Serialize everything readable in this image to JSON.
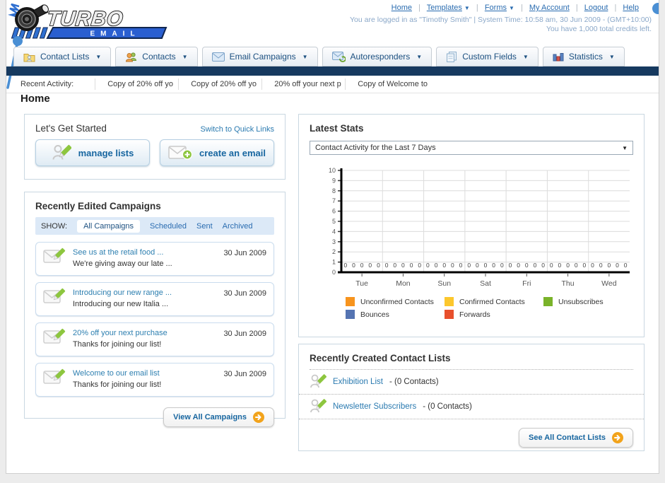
{
  "colors": {
    "accent_blue": "#2a6cb0",
    "link_teal": "#2d7fb0",
    "navy_bar": "#16395f",
    "button_text_blue": "#1766a0",
    "orange_button": "#f2a31b"
  },
  "header": {
    "logo_title": "TURBO",
    "logo_subtitle": "EMAIL",
    "nav_links": [
      {
        "label": "Home",
        "dropdown": false
      },
      {
        "label": "Templates",
        "dropdown": true
      },
      {
        "label": "Forms",
        "dropdown": true
      },
      {
        "label": "My Account",
        "dropdown": false
      },
      {
        "label": "Logout",
        "dropdown": false
      },
      {
        "label": "Help",
        "dropdown": false
      }
    ],
    "login_line": "You are logged in as \"Timothy Smith\" | System Time: 10:58 am, 30 Jun 2009 - (GMT+10:00)",
    "credits_line": "You have 1,000 total credits left."
  },
  "nav_tabs": {
    "items": [
      {
        "label": "Contact Lists",
        "icon": "contact-lists-icon"
      },
      {
        "label": "Contacts",
        "icon": "contacts-icon"
      },
      {
        "label": "Email Campaigns",
        "icon": "email-campaigns-icon"
      },
      {
        "label": "Autoresponders",
        "icon": "autoresponders-icon"
      },
      {
        "label": "Custom Fields",
        "icon": "custom-fields-icon"
      },
      {
        "label": "Statistics",
        "icon": "statistics-icon"
      }
    ]
  },
  "recent_activity": {
    "label": "Recent Activity:",
    "items": [
      "Copy of 20% off yo",
      "Copy of 20% off yo",
      "20% off your next p",
      "Copy of Welcome to"
    ]
  },
  "home": {
    "title": "Home"
  },
  "get_started": {
    "title": "Let's Get Started",
    "switch_link": "Switch to Quick Links",
    "buttons": [
      {
        "label": "manage lists",
        "icon": "manage-lists-icon"
      },
      {
        "label": "create an email",
        "icon": "create-email-icon"
      }
    ]
  },
  "campaigns": {
    "title": "Recently Edited Campaigns",
    "show_label": "SHOW:",
    "filters": [
      {
        "label": "All Campaigns",
        "active": true
      },
      {
        "label": "Scheduled",
        "active": false
      },
      {
        "label": "Sent",
        "active": false
      },
      {
        "label": "Archived",
        "active": false
      }
    ],
    "items": [
      {
        "title": "See us at the retail food ...",
        "subtitle": "We're giving away our late ...",
        "date": "30 Jun 2009"
      },
      {
        "title": "Introducing our new range ...",
        "subtitle": "Introducing our new Italia ...",
        "date": "30 Jun 2009"
      },
      {
        "title": "20% off your next purchase",
        "subtitle": "Thanks for joining our list!",
        "date": "30 Jun 2009"
      },
      {
        "title": "Welcome to our email list",
        "subtitle": "Thanks for joining our list!",
        "date": "30 Jun 2009"
      }
    ],
    "view_all_label": "View All Campaigns"
  },
  "stats": {
    "title": "Latest Stats",
    "selected_option": "Contact Activity for the Last 7 Days",
    "chart_data": {
      "type": "bar",
      "title": "Contact Activity for the Last 7 Days",
      "categories": [
        "Tue",
        "Mon",
        "Sun",
        "Sat",
        "Fri",
        "Thu",
        "Wed"
      ],
      "series": [
        {
          "name": "Unconfirmed Contacts",
          "color": "#f7941e",
          "values": [
            0,
            0,
            0,
            0,
            0,
            0,
            0
          ]
        },
        {
          "name": "Confirmed Contacts",
          "color": "#fcc72d",
          "values": [
            0,
            0,
            0,
            0,
            0,
            0,
            0
          ]
        },
        {
          "name": "Unsubscribes",
          "color": "#7ab32a",
          "values": [
            0,
            0,
            0,
            0,
            0,
            0,
            0
          ]
        },
        {
          "name": "Bounces",
          "color": "#5574b2",
          "values": [
            0,
            0,
            0,
            0,
            0,
            0,
            0
          ]
        },
        {
          "name": "Forwards",
          "color": "#e8502d",
          "values": [
            0,
            0,
            0,
            0,
            0,
            0,
            0
          ]
        }
      ],
      "ylim": [
        0,
        10
      ],
      "yticks": [
        0,
        1,
        2,
        3,
        4,
        5,
        6,
        7,
        8,
        9,
        10
      ],
      "grid": true,
      "show_value_labels": true,
      "legend_position": "bottom"
    }
  },
  "contact_lists": {
    "title": "Recently Created Contact Lists",
    "items": [
      {
        "name": "Exhibition List",
        "detail": "- (0 Contacts)"
      },
      {
        "name": "Newsletter Subscribers",
        "detail": "- (0 Contacts)"
      }
    ],
    "see_all_label": "See All Contact Lists"
  }
}
